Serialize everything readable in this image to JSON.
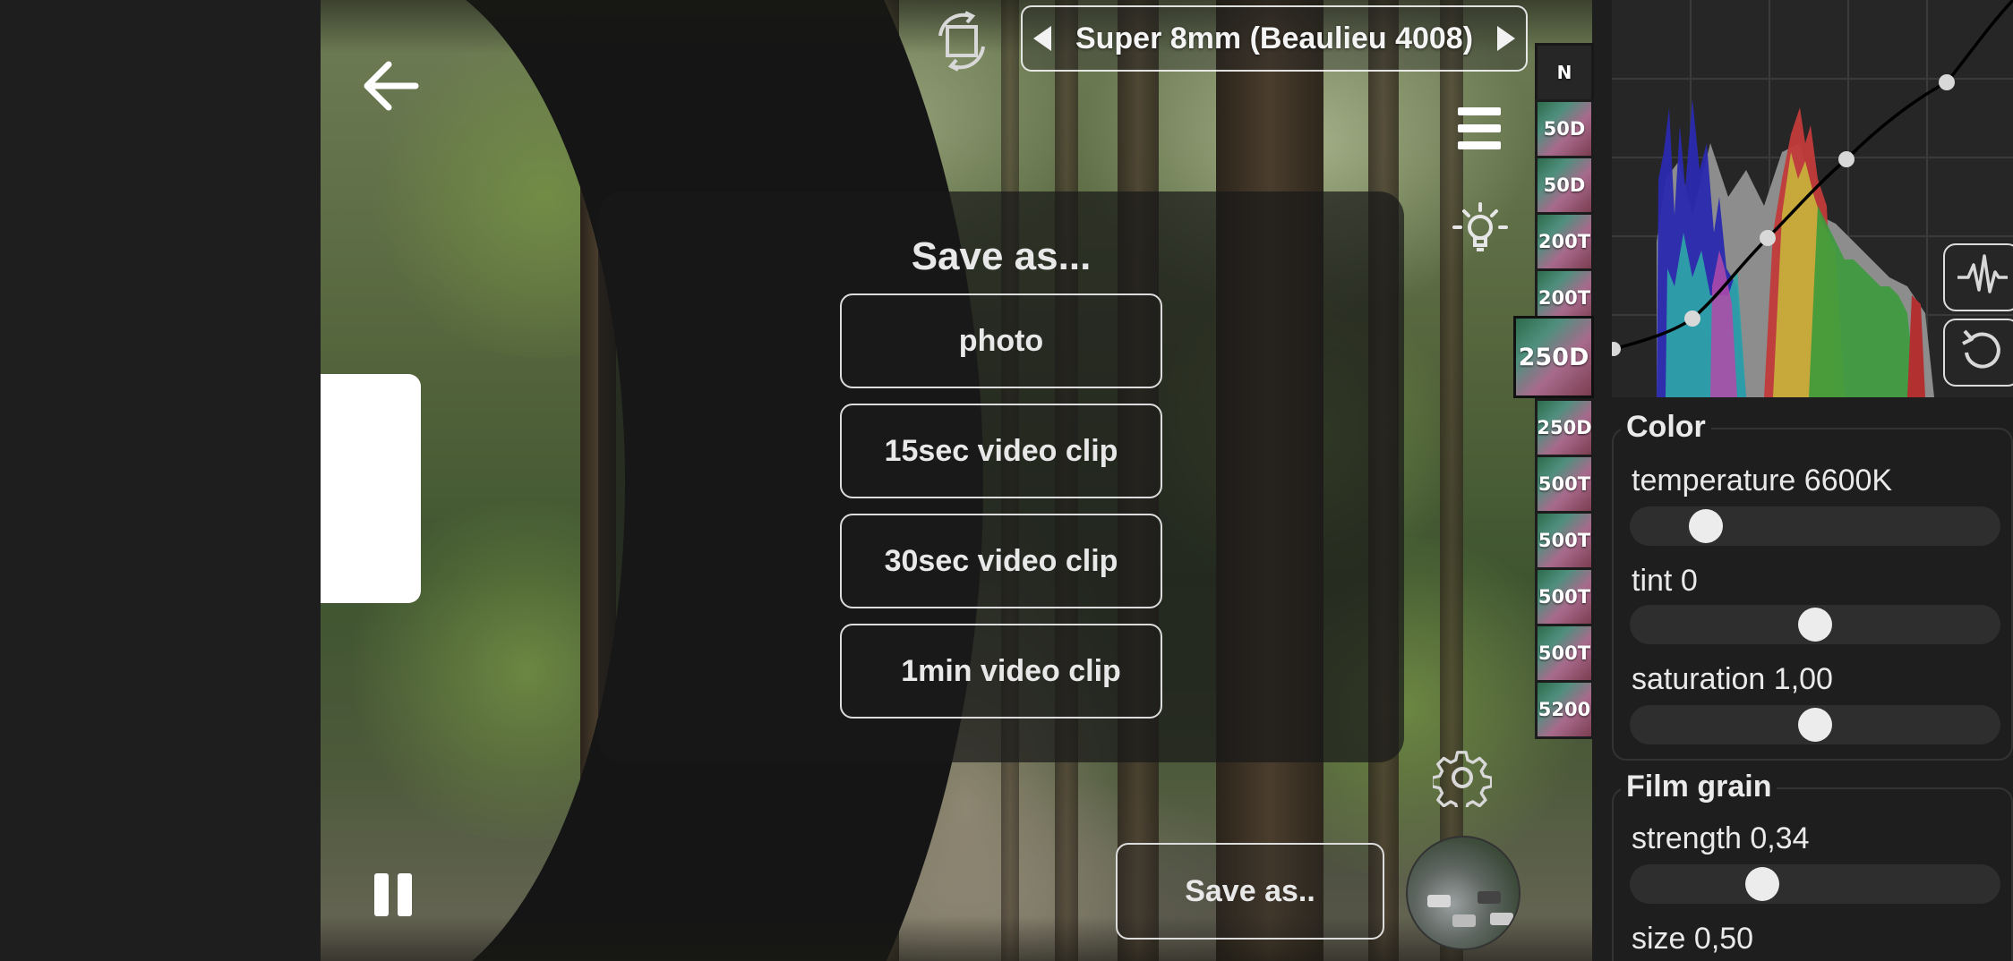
{
  "film_selector": {
    "name": "Super 8mm (Beaulieu 4008)"
  },
  "dialog": {
    "title": "Save as...",
    "options": [
      "photo",
      "15sec video clip",
      "30sec video clip",
      "1min video clip"
    ]
  },
  "save_button_label": "Save as..",
  "film_stocks": [
    {
      "label": "N",
      "active": false
    },
    {
      "label": "50D",
      "active": false
    },
    {
      "label": "50D",
      "active": false
    },
    {
      "label": "200T",
      "active": false
    },
    {
      "label": "200T",
      "active": false
    },
    {
      "label": "250D",
      "active": true
    },
    {
      "label": "250D",
      "active": false
    },
    {
      "label": "500T",
      "active": false
    },
    {
      "label": "500T",
      "active": false
    },
    {
      "label": "500T",
      "active": false
    },
    {
      "label": "500T",
      "active": false
    },
    {
      "label": "5200",
      "active": false
    }
  ],
  "icons": {
    "back": "arrow-left-icon",
    "pause": "pause-icon",
    "rotate": "rotate-frame-icon",
    "menu": "hamburger-menu-icon",
    "light": "lightbulb-icon",
    "settings": "gear-icon",
    "waveform": "waveform-icon",
    "reset": "reset-icon"
  },
  "color": {
    "title": "Color",
    "temperature": {
      "label": "temperature",
      "value": "6600K",
      "level": 0.17
    },
    "tint": {
      "label": "tint",
      "value": "0",
      "level": 0.5
    },
    "saturation": {
      "label": "saturation",
      "value": "1,00",
      "level": 0.5
    }
  },
  "film_grain": {
    "title": "Film grain",
    "strength": {
      "label": "strength",
      "value": "0,34",
      "level": 0.34
    },
    "size": {
      "label": "size",
      "value": "0,50"
    }
  },
  "colors": {
    "panel_bg": "#1e1e1e",
    "accent": "#ececec"
  }
}
